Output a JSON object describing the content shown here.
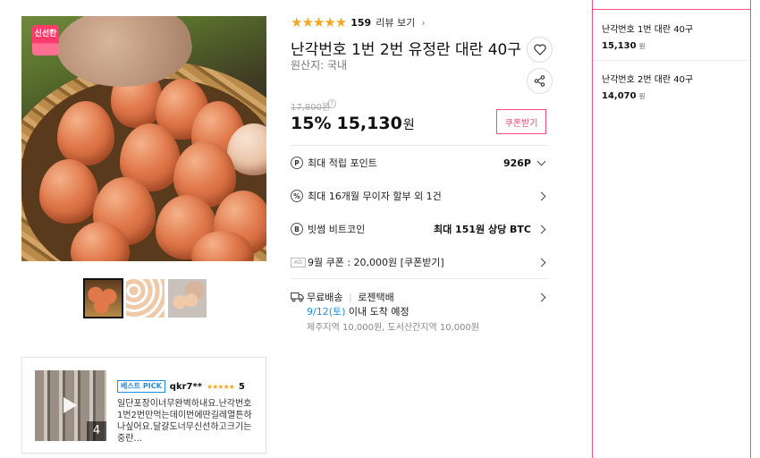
{
  "product": {
    "badge": "신선한",
    "thumbnails": [
      "thumb-1",
      "thumb-2",
      "thumb-3"
    ],
    "rating_count": "159",
    "review_link": "리뷰 보기",
    "title": "난각번호 1번 2번 유정란 대란 40구",
    "origin": "원산지:  국내",
    "original_price": "17,800원",
    "discount": "15%",
    "sale_price": "15,130",
    "currency": "원",
    "coupon_button": "쿠폰받기"
  },
  "benefits": [
    {
      "icon": "P",
      "label": "최대 적립 포인트",
      "value": "926P"
    },
    {
      "icon": "%",
      "label": "최대 16개월 무이자 할부 외 1건",
      "value": ""
    },
    {
      "icon": "B",
      "label": "빗썸 비트코인",
      "value": "최대 151원 상당 BTC"
    },
    {
      "icon": "AD",
      "label": "9월 쿠폰 : 20,000원 [쿠폰받기]",
      "value": ""
    }
  ],
  "shipping": {
    "label": "무료배송",
    "carrier": "로젠택배",
    "date": "9/12(토)",
    "date_suffix": " 이내 도착 예정",
    "extra": "제주지역 10,000원, 도서산간지역 10,000원"
  },
  "review": {
    "badge": "베스트 PICK",
    "user": "qkr7**",
    "stars": "★★★★★",
    "score": "5",
    "media_count": "4",
    "text": "일단포장이너무완벽하내요.난각번호1번2번만먹는데이번에딴길레열튼하나싶어요.달걀도너무신선하고크기는중란…"
  },
  "side_options": [
    {
      "name": "난각번호 1번 대란 40구",
      "price": "15,130",
      "unit": "원"
    },
    {
      "name": "난각번호 2번 대란 40구",
      "price": "14,070",
      "unit": "원"
    }
  ]
}
